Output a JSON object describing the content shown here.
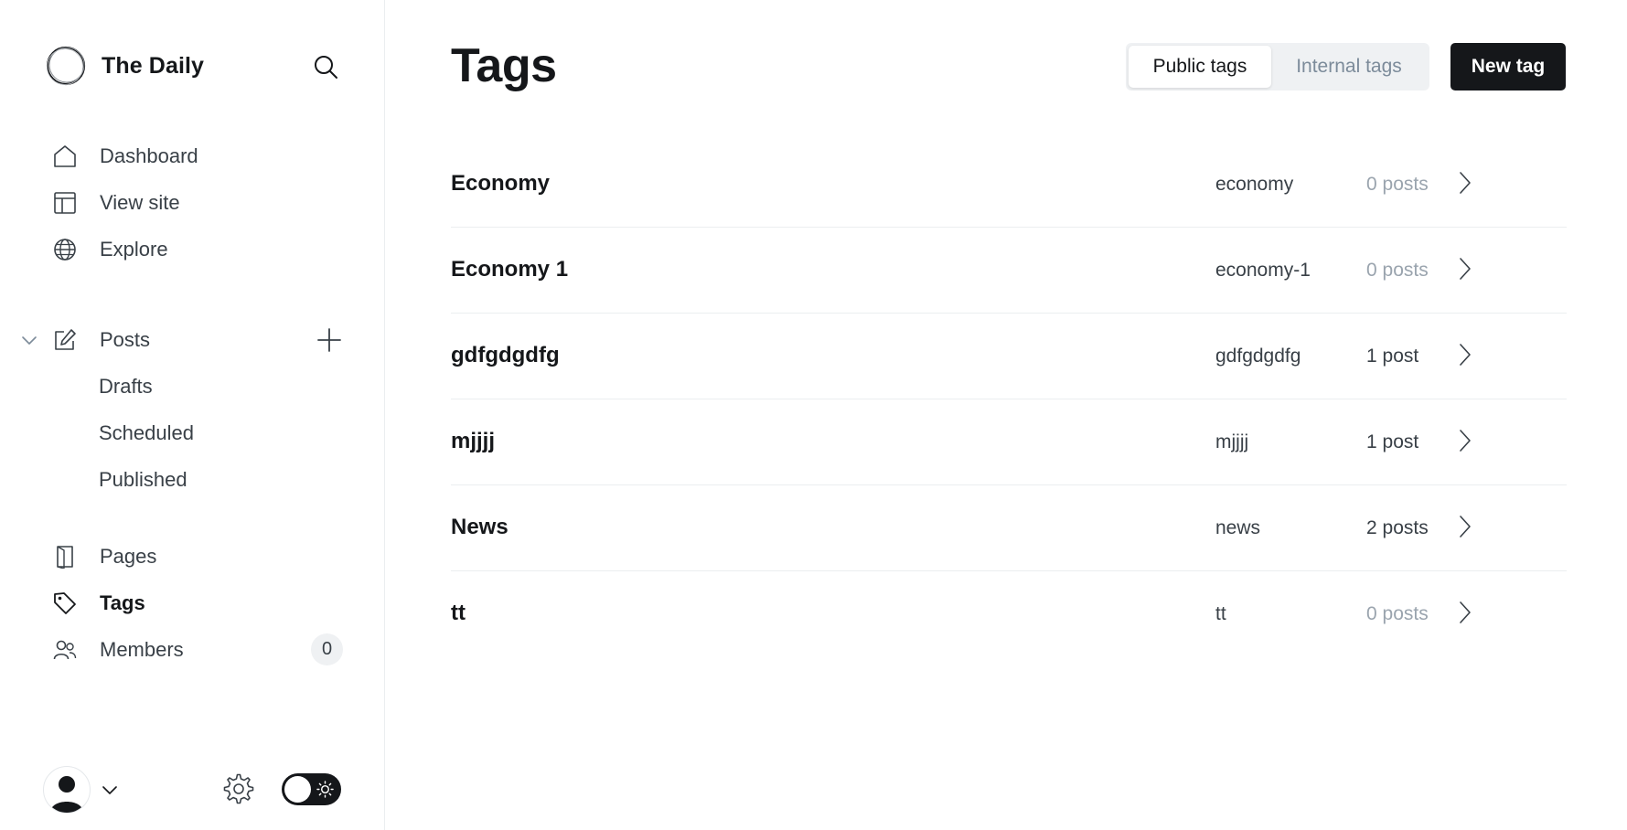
{
  "site": {
    "name": "The Daily"
  },
  "icons": {
    "search": "search-icon",
    "logo": "site-logo-icon"
  },
  "sidebar": {
    "primary": [
      {
        "label": "Dashboard",
        "icon": "home-icon"
      },
      {
        "label": "View site",
        "icon": "layout-icon"
      },
      {
        "label": "Explore",
        "icon": "globe-icon"
      }
    ],
    "posts": {
      "label": "Posts",
      "icon": "edit-icon",
      "expanded": true,
      "sub_items": [
        "Drafts",
        "Scheduled",
        "Published"
      ]
    },
    "secondary": [
      {
        "label": "Pages",
        "icon": "page-icon",
        "active": false
      },
      {
        "label": "Tags",
        "icon": "tag-icon",
        "active": true
      },
      {
        "label": "Members",
        "icon": "members-icon",
        "active": false,
        "badge": "0"
      }
    ]
  },
  "footer": {
    "theme": "light",
    "icons": [
      "avatar",
      "chevron-down-icon",
      "gear-icon",
      "sun-icon"
    ]
  },
  "main": {
    "title": "Tags",
    "tabs": {
      "public": "Public tags",
      "internal": "Internal tags",
      "selected": "public"
    },
    "new_tag_label": "New tag",
    "tags": [
      {
        "name": "Economy",
        "slug": "economy",
        "count": "0 posts",
        "zero": true
      },
      {
        "name": "Economy 1",
        "slug": "economy-1",
        "count": "0 posts",
        "zero": true
      },
      {
        "name": "gdfgdgdfg",
        "slug": "gdfgdgdfg",
        "count": "1 post",
        "zero": false
      },
      {
        "name": "mjjjj",
        "slug": "mjjjj",
        "count": "1 post",
        "zero": false
      },
      {
        "name": "News",
        "slug": "news",
        "count": "2 posts",
        "zero": false
      },
      {
        "name": "tt",
        "slug": "tt",
        "count": "0 posts",
        "zero": true
      }
    ]
  },
  "colors": {
    "text_primary": "#15171a",
    "text_secondary": "#394047",
    "text_muted": "#9aa4ae",
    "button_dark": "#15171a",
    "divider": "#ebeef0",
    "badge_bg": "#eff1f3"
  }
}
